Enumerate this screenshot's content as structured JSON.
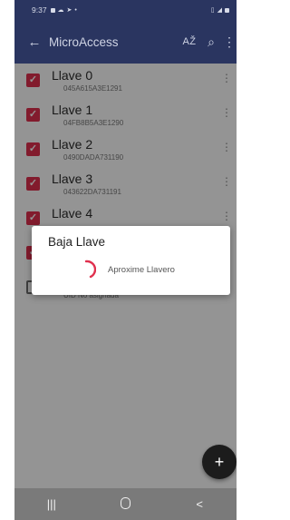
{
  "status_bar": {
    "time": "9:37",
    "left_icons": [
      "image-icon",
      "cloud-icon",
      "navigation-icon"
    ],
    "dot": "•",
    "right_icons": [
      "vibrate-icon",
      "signal-icon",
      "battery-icon"
    ]
  },
  "app_bar": {
    "back_glyph": "←",
    "title": "MicroAccess",
    "sort_glyph": "AŽ",
    "search_glyph": "⌕",
    "more_glyph": "⋮"
  },
  "keys": [
    {
      "name": "Llave 0",
      "uid": "045A615A3E1291",
      "checked": true
    },
    {
      "name": "Llave 1",
      "uid": "04FB8B5A3E1290",
      "checked": true
    },
    {
      "name": "Llave 2",
      "uid": "0490DADA731190",
      "checked": true
    },
    {
      "name": "Llave 3",
      "uid": "043622DA731191",
      "checked": true
    },
    {
      "name": "Llave 4",
      "uid": "",
      "checked": true
    },
    {
      "name": "",
      "uid": "",
      "checked": true
    },
    {
      "name": "",
      "uid": "UID No asignada",
      "checked": false
    }
  ],
  "dialog": {
    "title": "Baja Llave",
    "message": "Aproxime Llavero"
  },
  "fab": {
    "label": "+"
  },
  "nav_bar": {
    "recents": "|||",
    "back": "<"
  },
  "colors": {
    "primary": "#2a3560",
    "accent": "#e0304e",
    "fab": "#1c1c1c"
  }
}
